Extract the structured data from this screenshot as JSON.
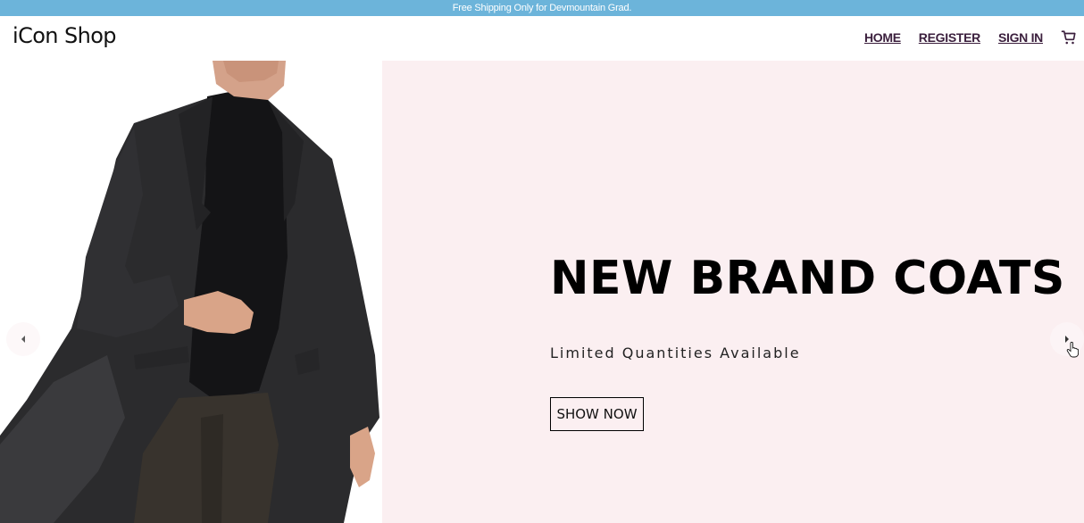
{
  "announcement": "Free Shipping Only for Devmountain Grad.",
  "header": {
    "logo": "iCon Shop",
    "nav": {
      "home": "HOME",
      "register": "REGISTER",
      "sign_in": "SIGN IN"
    },
    "cart_icon": "shopping-cart-icon"
  },
  "hero": {
    "title": "NEW BRAND COATS",
    "subtitle": "Limited Quantities Available",
    "button": "SHOW NOW",
    "panel_color": "#fbeff1",
    "prev_icon": "caret-left-icon",
    "next_icon": "caret-right-icon"
  },
  "colors": {
    "announcement_bg": "#6cb4da",
    "nav_link": "#3b1f3d"
  }
}
